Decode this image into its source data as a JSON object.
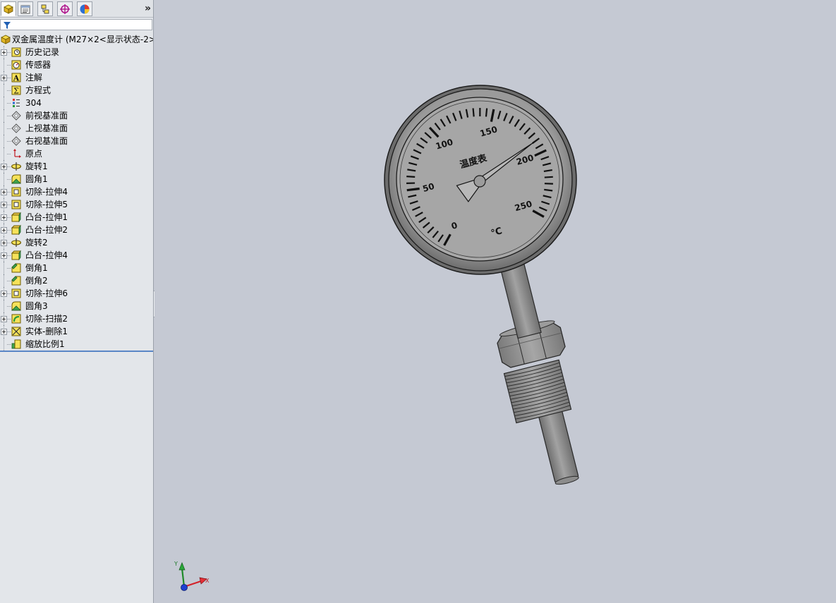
{
  "feature_manager": {
    "tabs": [
      {
        "name": "featuremanager-tab",
        "active": true
      },
      {
        "name": "propertymanager-tab",
        "active": false
      },
      {
        "name": "configurationmanager-tab",
        "active": false
      },
      {
        "name": "dimxpertmanager-tab",
        "active": false
      },
      {
        "name": "displaymanager-tab",
        "active": false
      }
    ],
    "more_label": "»",
    "root": {
      "label": "双金属温度计  (M27×2<显示状态-2>"
    },
    "items": [
      {
        "label": "历史记录",
        "icon": "history-icon",
        "expandable": true
      },
      {
        "label": "传感器",
        "icon": "sensor-icon",
        "expandable": false
      },
      {
        "label": "注解",
        "icon": "annotation-icon",
        "expandable": true
      },
      {
        "label": "方程式",
        "icon": "equation-icon",
        "expandable": false
      },
      {
        "label": "304",
        "icon": "material-icon",
        "expandable": false
      },
      {
        "label": "前视基准面",
        "icon": "plane-icon",
        "expandable": false
      },
      {
        "label": "上视基准面",
        "icon": "plane-icon",
        "expandable": false
      },
      {
        "label": "右视基准面",
        "icon": "plane-icon",
        "expandable": false
      },
      {
        "label": "原点",
        "icon": "origin-icon",
        "expandable": false
      },
      {
        "label": "旋转1",
        "icon": "revolve-icon",
        "expandable": true
      },
      {
        "label": "圆角1",
        "icon": "fillet-icon",
        "expandable": false
      },
      {
        "label": "切除-拉伸4",
        "icon": "cut-extrude-icon",
        "expandable": true
      },
      {
        "label": "切除-拉伸5",
        "icon": "cut-extrude-icon",
        "expandable": true
      },
      {
        "label": "凸台-拉伸1",
        "icon": "boss-extrude-icon",
        "expandable": true
      },
      {
        "label": "凸台-拉伸2",
        "icon": "boss-extrude-icon",
        "expandable": true
      },
      {
        "label": "旋转2",
        "icon": "revolve-icon",
        "expandable": true
      },
      {
        "label": "凸台-拉伸4",
        "icon": "boss-extrude-icon",
        "expandable": true
      },
      {
        "label": "倒角1",
        "icon": "chamfer-icon",
        "expandable": false
      },
      {
        "label": "倒角2",
        "icon": "chamfer-icon",
        "expandable": false
      },
      {
        "label": "切除-拉伸6",
        "icon": "cut-extrude-icon",
        "expandable": true
      },
      {
        "label": "圆角3",
        "icon": "fillet-icon",
        "expandable": false
      },
      {
        "label": "切除-扫描2",
        "icon": "cut-sweep-icon",
        "expandable": true
      },
      {
        "label": "实体-删除1",
        "icon": "delete-body-icon",
        "expandable": true
      },
      {
        "label": "缩放比例1",
        "icon": "scale-icon",
        "expandable": false
      }
    ]
  },
  "model": {
    "dial_title": "温度表",
    "unit": "℃",
    "scale_labels": [
      "0",
      "50",
      "100",
      "150",
      "200",
      "250"
    ],
    "pointer_value": 190
  },
  "triad": {
    "x_label": "X",
    "y_label": "Y"
  },
  "colors": {
    "viewport_bg": "#c5c9d3",
    "panel_bg": "#e3e6ea",
    "gauge_metal": "#8e8e8e",
    "dial_face": "#a9a9a9",
    "feature_yellow": "#f6e25a"
  }
}
